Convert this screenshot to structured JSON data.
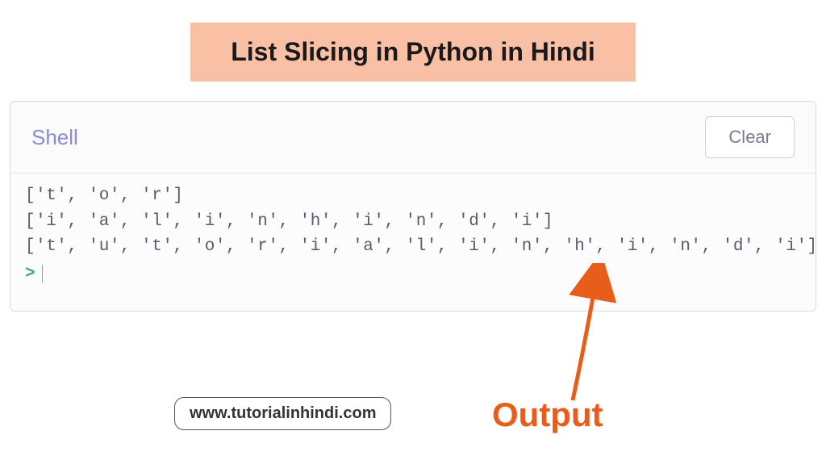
{
  "title": "List Slicing in Python in Hindi",
  "console": {
    "header_label": "Shell",
    "clear_button": "Clear",
    "lines": [
      "['t', 'o', 'r']",
      "['i', 'a', 'l', 'i', 'n', 'h', 'i', 'n', 'd', 'i']",
      "['t', 'u', 't', 'o', 'r', 'i', 'a', 'l', 'i', 'n', 'h', 'i', 'n', 'd', 'i']"
    ],
    "prompt": ">"
  },
  "annotation": {
    "label": "Output"
  },
  "website": "www.tutorialinhindi.com",
  "colors": {
    "title_bg": "#fac0a6",
    "accent": "#e85d1a",
    "shell_purple": "#8b8ad8",
    "prompt_green": "#3ba870"
  }
}
